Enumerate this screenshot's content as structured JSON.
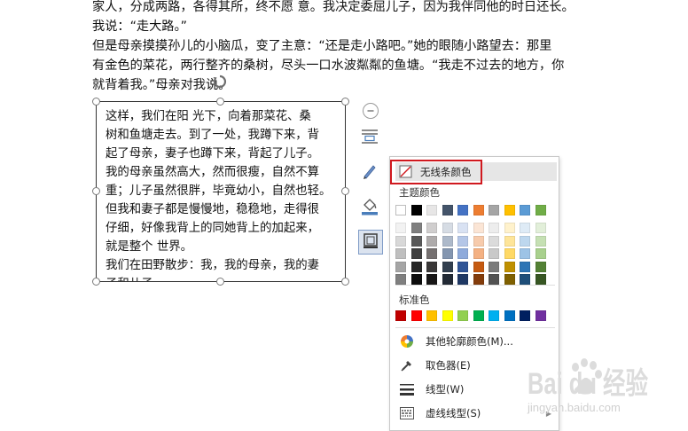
{
  "document": {
    "lines": [
      "家人，分成两路，各得其所，终不愿    意。我决定委屈儿子，因为我伴同他的时日还长。",
      "我说：“走大路。”",
      "但是母亲摸摸孙儿的小脑瓜，变了主意：“还是走小路吧。”她的眼随小路望去：那里",
      "有金色的菜花，两行整齐的桑树，尽头一口水波粼粼的鱼塘。“我走不过去的地方，你",
      "就背着我。”母亲对我说。"
    ]
  },
  "textbox": {
    "lines": [
      "这样，我们在阳  光下，向着那菜花、桑",
      "树和鱼塘走去。到了一处，我蹲下来，背",
      "起了母亲，妻子也蹲下来，背起了儿子。",
      "我的母亲虽然高大，然而很瘦，自然不算",
      "重；儿子虽然很胖，毕竟幼小，自然也轻。",
      "但我和妻子都是慢慢地，稳稳地，走得很",
      "仔细，好像我背上的同她背上的加起来，",
      "就是整个  世界。",
      "我们在田野散步：我，我的母亲，我的妻",
      "子和儿子。"
    ]
  },
  "side_toolbar": {
    "collapse_icon": "minus-circle-icon",
    "buttons": [
      "layout-options-icon",
      "pen-icon",
      "fill-bucket-icon",
      "shape-outline-icon"
    ]
  },
  "outline_menu": {
    "no_line_label": "无线条颜色",
    "theme_colors_label": "主题颜色",
    "standard_colors_label": "标准色",
    "theme_top_row": [
      "#ffffff",
      "#000000",
      "#e7e6e6",
      "#44546a",
      "#4472c4",
      "#ed7d31",
      "#a5a5a5",
      "#ffc000",
      "#5b9bd5",
      "#70ad47"
    ],
    "theme_shades": [
      [
        "#f2f2f2",
        "#7f7f7f",
        "#d0cece",
        "#d6dce4",
        "#d9e2f3",
        "#fbe5d5",
        "#ededed",
        "#fff2cc",
        "#deebf6",
        "#e2efd9"
      ],
      [
        "#d8d8d8",
        "#595959",
        "#aeabab",
        "#adb9ca",
        "#b4c6e7",
        "#f7cbac",
        "#dbdbdb",
        "#fee599",
        "#bdd7ee",
        "#c5e0b3"
      ],
      [
        "#bfbfbf",
        "#3f3f3f",
        "#757070",
        "#8496b0",
        "#8eaadb",
        "#f4b183",
        "#c9c9c9",
        "#ffd965",
        "#9dc3e6",
        "#a8d08d"
      ],
      [
        "#a5a5a5",
        "#262626",
        "#3a3838",
        "#323f4f",
        "#2f5496",
        "#c55a11",
        "#7b7b7b",
        "#bf9000",
        "#2e75b5",
        "#538135"
      ],
      [
        "#7f7f7f",
        "#0c0c0c",
        "#171616",
        "#222a35",
        "#1f3864",
        "#833c0b",
        "#525252",
        "#7f6000",
        "#1e4e79",
        "#375623"
      ]
    ],
    "standard_colors": [
      "#c00000",
      "#ff0000",
      "#ffc000",
      "#ffff00",
      "#92d050",
      "#00b050",
      "#00b0f0",
      "#0070c0",
      "#002060",
      "#7030a0"
    ],
    "items": [
      {
        "label": "其他轮廓颜色(M)...",
        "icon": "color-wheel-icon"
      },
      {
        "label": "取色器(E)",
        "icon": "eyedropper-icon"
      },
      {
        "label": "线型(W)",
        "icon": "line-weight-icon"
      },
      {
        "label": "虚线线型(S)",
        "icon": "dash-type-icon"
      }
    ]
  },
  "watermark": {
    "brand_text": "Bai du 经验",
    "sub_text": "jingyan.baidu.com"
  }
}
